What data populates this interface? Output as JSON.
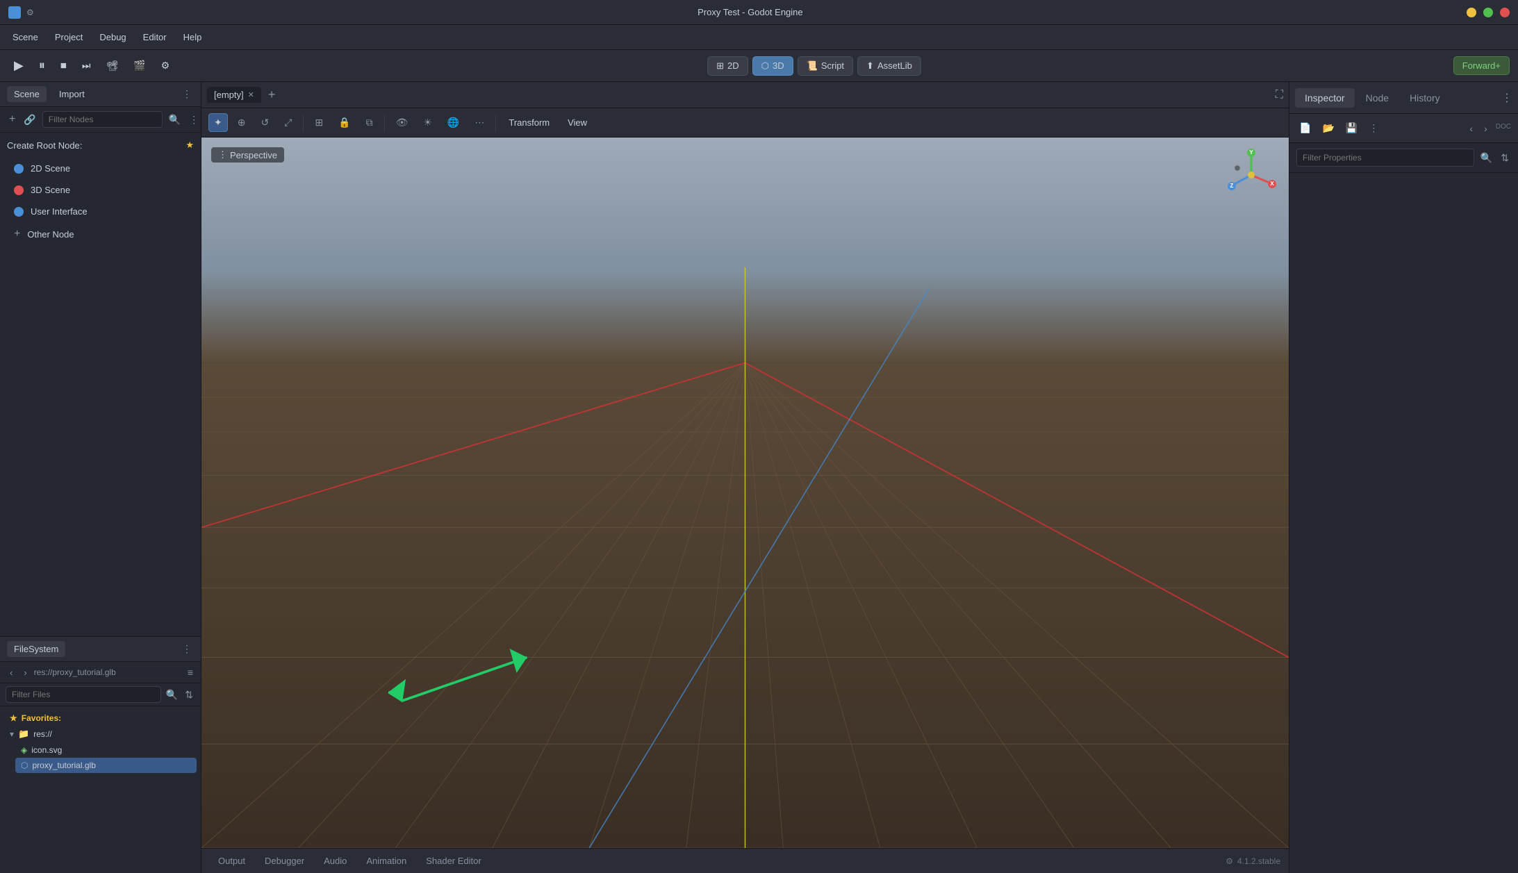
{
  "titlebar": {
    "title": "Proxy Test - Godot Engine",
    "icon": "godot-icon"
  },
  "menubar": {
    "items": [
      "Scene",
      "Project",
      "Debug",
      "Editor",
      "Help"
    ]
  },
  "toolbar": {
    "mode_2d": "2D",
    "mode_3d": "3D",
    "script": "Script",
    "assetlib": "AssetLib",
    "forward_renderer": "Forward+"
  },
  "scene_panel": {
    "tabs": [
      "Scene",
      "Import"
    ],
    "create_root_label": "Create Root Node:",
    "nodes": [
      {
        "label": "2D Scene",
        "type": "2d"
      },
      {
        "label": "3D Scene",
        "type": "3d"
      },
      {
        "label": "User Interface",
        "type": "ui"
      }
    ],
    "other_node": "Other Node",
    "filter_placeholder": "Filter Nodes"
  },
  "filesystem_panel": {
    "title": "FileSystem",
    "path": "res://proxy_tutorial.glb",
    "filter_placeholder": "Filter Files",
    "favorites_label": "Favorites:",
    "tree": [
      {
        "name": "res://",
        "type": "folder",
        "indent": 0
      },
      {
        "name": "icon.svg",
        "type": "svg",
        "indent": 1
      },
      {
        "name": "proxy_tutorial.glb",
        "type": "glb",
        "indent": 1,
        "selected": true
      }
    ]
  },
  "viewport": {
    "tab_label": "[empty]",
    "perspective_label": "Perspective",
    "toolbar_buttons": [
      "select",
      "move",
      "rotate",
      "scale",
      "transform_mode",
      "lock",
      "group",
      "camera",
      "sun",
      "dots",
      "more"
    ],
    "transform_label": "Transform",
    "view_label": "View"
  },
  "inspector_panel": {
    "tabs": [
      "Inspector",
      "Node",
      "History"
    ],
    "filter_placeholder": "Filter Properties"
  },
  "bottom_tabs": {
    "items": [
      "Output",
      "Debugger",
      "Audio",
      "Animation",
      "Shader Editor"
    ],
    "version": "4.1.2.stable"
  },
  "gizmo": {
    "x_color": "#e05050",
    "y_color": "#50c050",
    "z_color": "#4a90d9",
    "center_color": "#e0c040"
  }
}
